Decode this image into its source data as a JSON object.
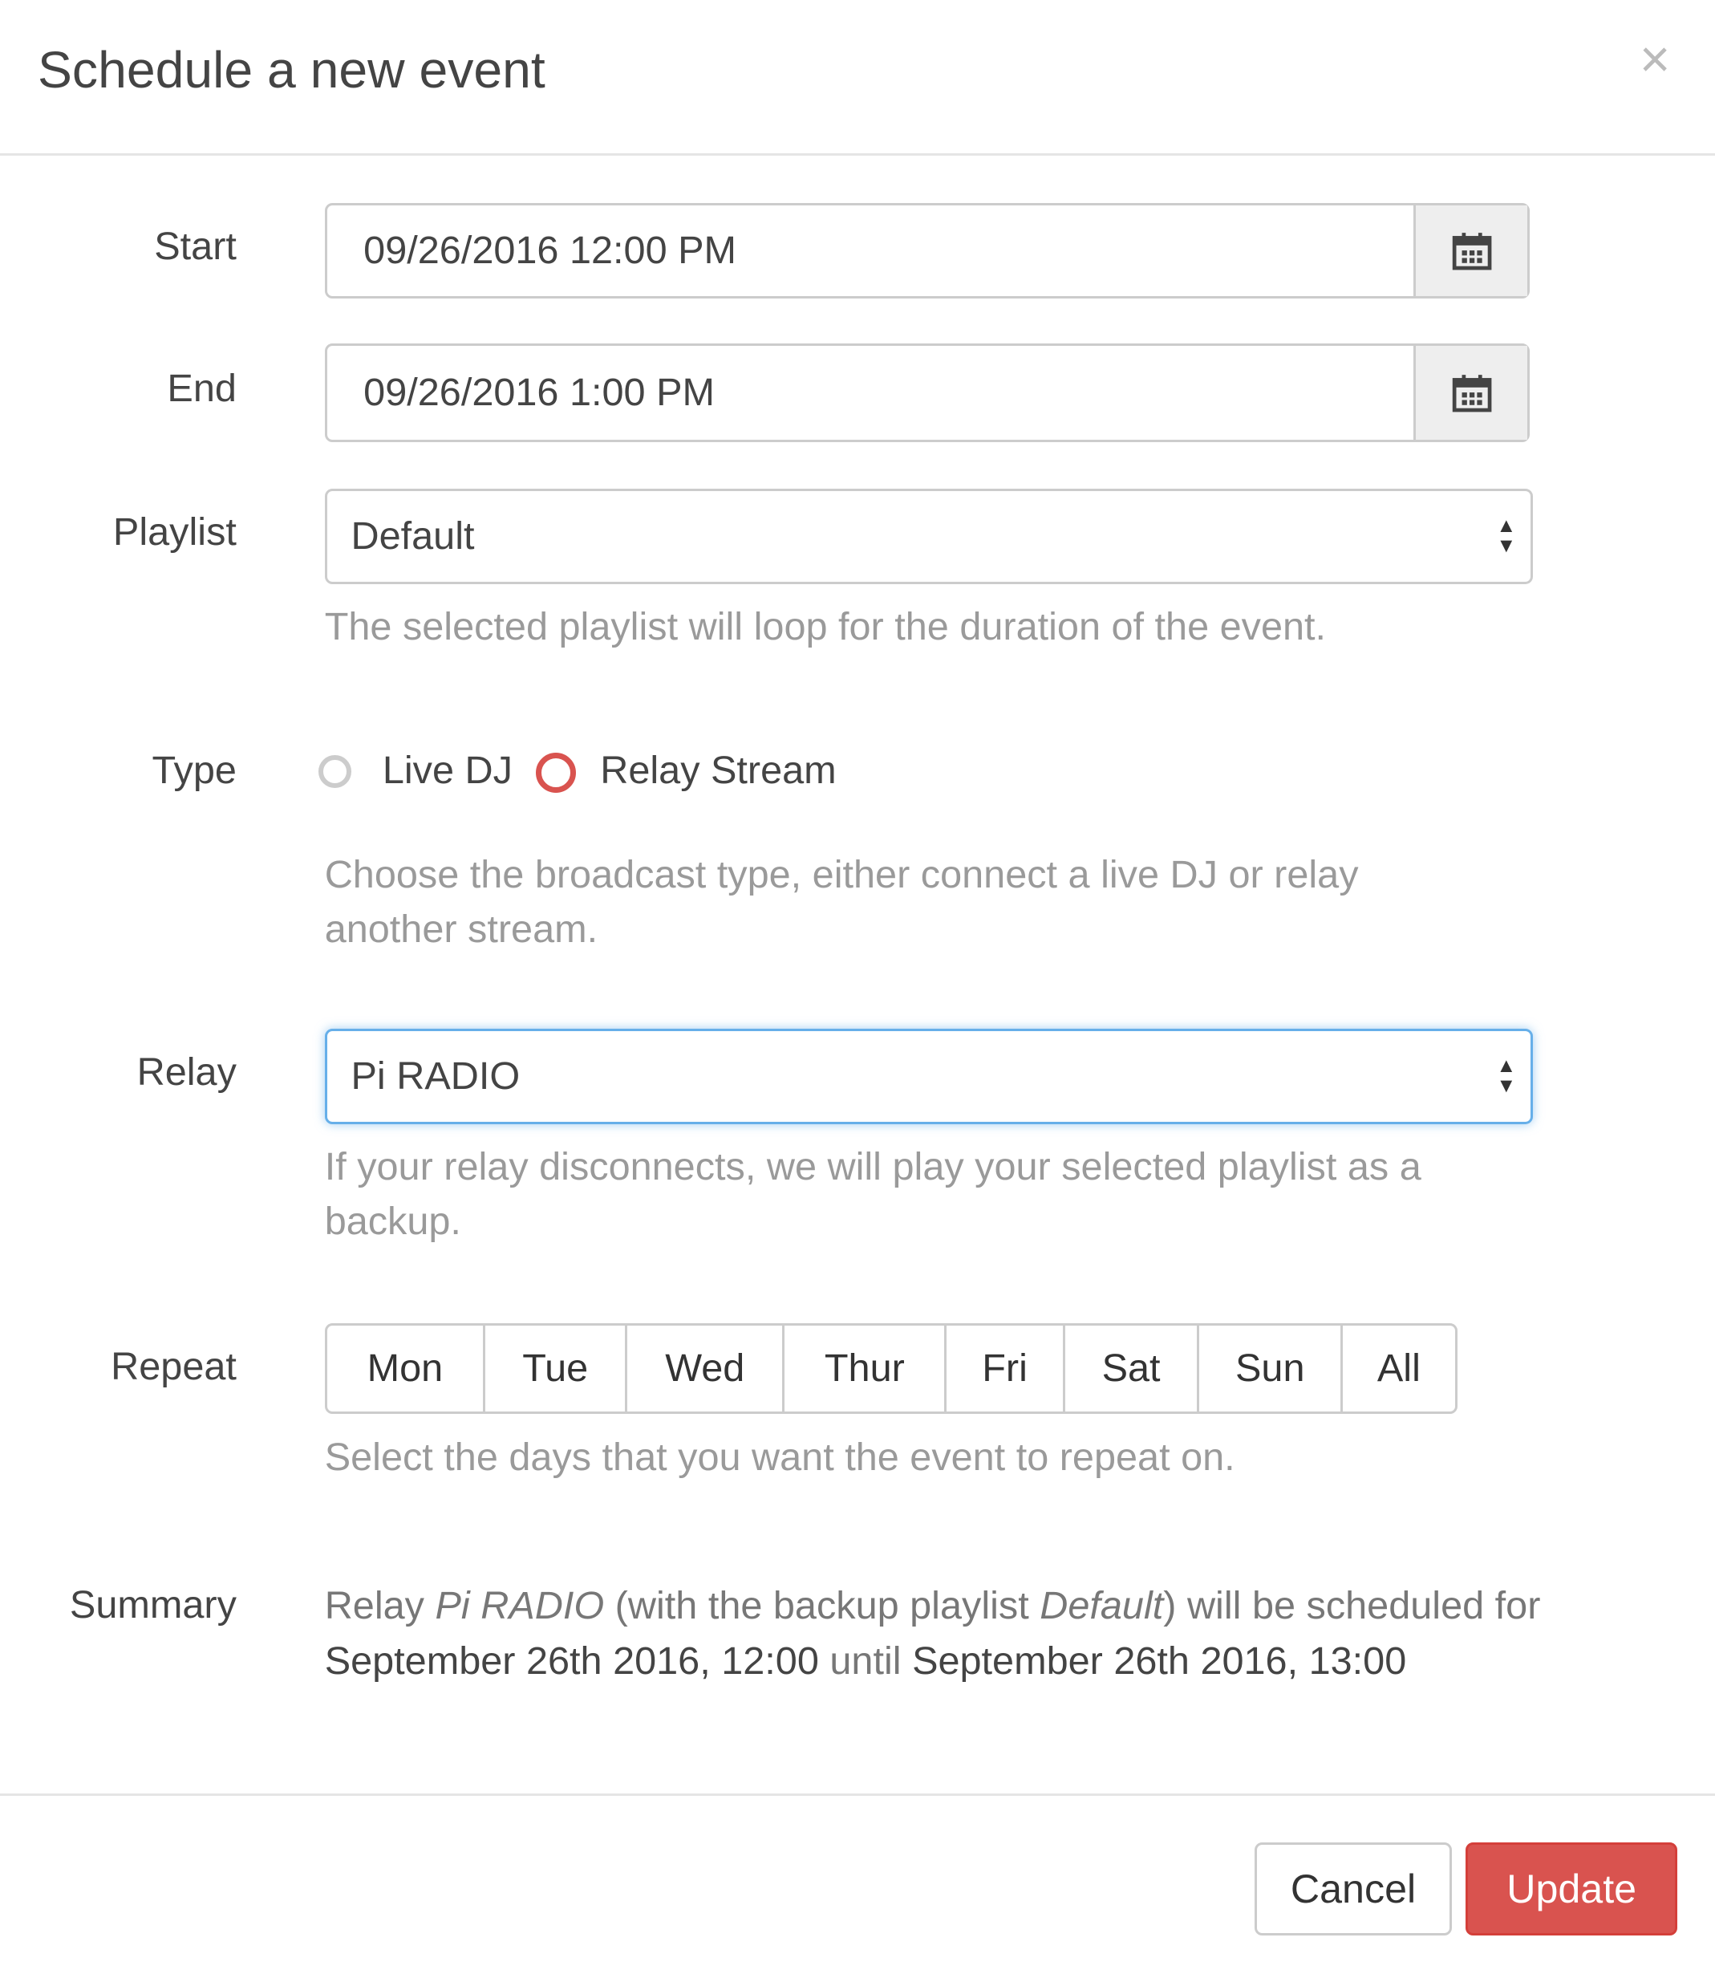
{
  "modal": {
    "title": "Schedule a new event",
    "close_label": "×"
  },
  "start": {
    "label": "Start",
    "value": "09/26/2016 12:00 PM"
  },
  "end": {
    "label": "End",
    "value": "09/26/2016 1:00 PM"
  },
  "playlist": {
    "label": "Playlist",
    "selected": "Default",
    "help": "The selected playlist will loop for the duration of the event."
  },
  "type": {
    "label": "Type",
    "options": [
      "Live DJ",
      "Relay Stream"
    ],
    "selected": "Relay Stream",
    "help": "Choose the broadcast type, either connect a live DJ or relay another stream."
  },
  "relay": {
    "label": "Relay",
    "selected": "Pi RADIO",
    "help": "If your relay disconnects, we will play your selected playlist as a backup."
  },
  "repeat": {
    "label": "Repeat",
    "days": [
      "Mon",
      "Tue",
      "Wed",
      "Thur",
      "Fri",
      "Sat",
      "Sun",
      "All"
    ],
    "help": "Select the days that you want the event to repeat on."
  },
  "summary": {
    "label": "Summary",
    "p1": "Relay ",
    "relay": "Pi RADIO",
    "p2": " (with the backup playlist ",
    "playlist": "Default",
    "p3": ") will be scheduled for ",
    "start": "September 26th 2016, 12:00",
    "p4": " until ",
    "end": "September 26th 2016, 13:00"
  },
  "footer": {
    "cancel": "Cancel",
    "update": "Update"
  },
  "colors": {
    "danger": "#d9534f",
    "focus": "#66afe9"
  }
}
